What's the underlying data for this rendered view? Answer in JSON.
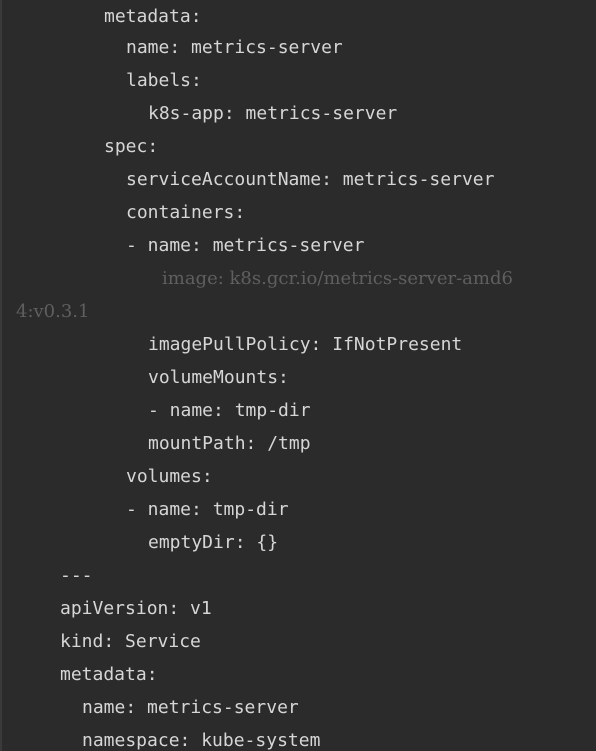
{
  "code_view": {
    "lines": [
      "metadata:",
      "name: metrics-server",
      "labels:",
      "k8s-app: metrics-server",
      "spec:",
      "serviceAccountName: metrics-server",
      "containers:",
      "- name: metrics-server",
      "image: k8s.gcr.io/metrics-server-amd6",
      "4:v0.3.1",
      "imagePullPolicy: IfNotPresent",
      "volumeMounts:",
      "- name: tmp-dir",
      "mountPath: /tmp",
      "volumes:",
      "- name: tmp-dir",
      "emptyDir: {}",
      "---",
      "apiVersion: v1",
      "kind: Service",
      "metadata:",
      "name: metrics-server",
      "namespace: kube-system"
    ]
  },
  "colors": {
    "background": "#2b2b2b",
    "text": "#d6d6d6",
    "dim_text": "#5f5f5f"
  }
}
